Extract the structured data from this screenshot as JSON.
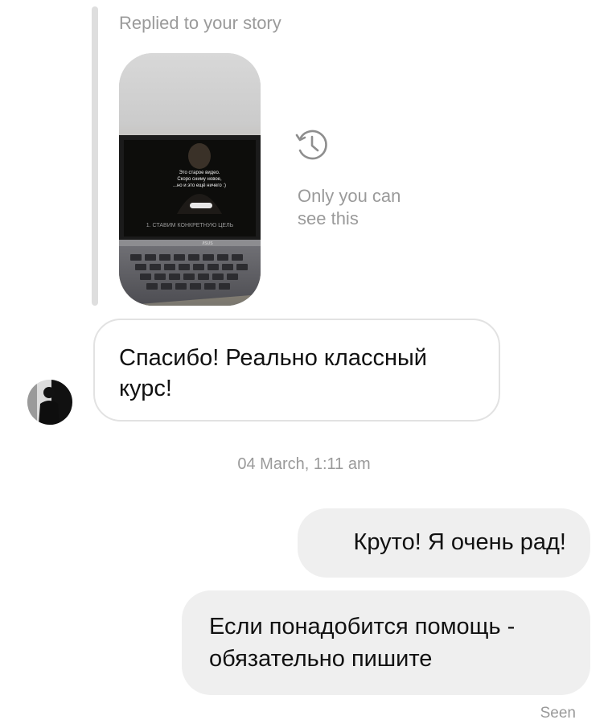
{
  "story_reply": {
    "caption": "Replied to your story",
    "privacy_line1": "Only you can",
    "privacy_line2": "see this",
    "thumbnail_overlay": {
      "line1": "Это старое видео.",
      "line2": "Скоро сниму новое,",
      "line3": "...но и это ещё ничего :)",
      "bottom": "1. СТАВИМ КОНКРЕТНУЮ ЦЕЛЬ",
      "brand": "/ISUS"
    }
  },
  "messages": {
    "incoming_1": {
      "line1": "Спасибо! Реально классный",
      "line2": "курс!"
    },
    "timestamp": "04 March, 1:11 am",
    "outgoing_1": "Круто! Я очень рад!",
    "outgoing_2": {
      "line1": "Если понадобится помощь -",
      "line2": "обязательно пишите"
    },
    "status": "Seen"
  },
  "icons": {
    "privacy": "history-clock-icon",
    "avatar": "user-avatar"
  }
}
